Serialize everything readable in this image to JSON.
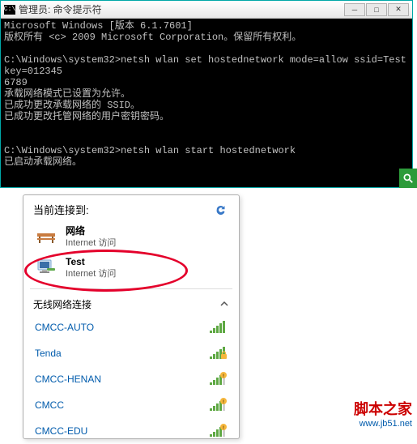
{
  "cmd": {
    "title": "管理员: 命令提示符",
    "body": "Microsoft Windows [版本 6.1.7601]\n版权所有 <c> 2009 Microsoft Corporation。保留所有权利。\n\nC:\\Windows\\system32>netsh wlan set hostednetwork mode=allow ssid=Test key=012345\n6789\n承载网络模式已设置为允许。\n已成功更改承载网络的 SSID。\n已成功更改托管网络的用户密钥密码。\n\n\nC:\\Windows\\system32>netsh wlan start hostednetwork\n已启动承载网络。\n\n\nC:\\Windows\\system32>"
  },
  "net": {
    "header": "当前连接到:",
    "wired": {
      "name": "网络",
      "sub": "Internet 访问"
    },
    "test": {
      "name": "Test",
      "sub": "Internet 访问"
    },
    "wl_header": "无线网络连接",
    "items": [
      {
        "name": "CMCC-AUTO",
        "locked": false,
        "bars": 5
      },
      {
        "name": "Tenda",
        "locked": true,
        "bars": 5
      },
      {
        "name": "CMCC-HENAN",
        "locked": false,
        "bars": 4,
        "warn": true
      },
      {
        "name": "CMCC",
        "locked": false,
        "bars": 4,
        "warn": true
      },
      {
        "name": "CMCC-EDU",
        "locked": false,
        "bars": 4,
        "warn": true
      }
    ]
  },
  "watermark": {
    "text": "脚本之家",
    "url": "www.jb51.net"
  }
}
